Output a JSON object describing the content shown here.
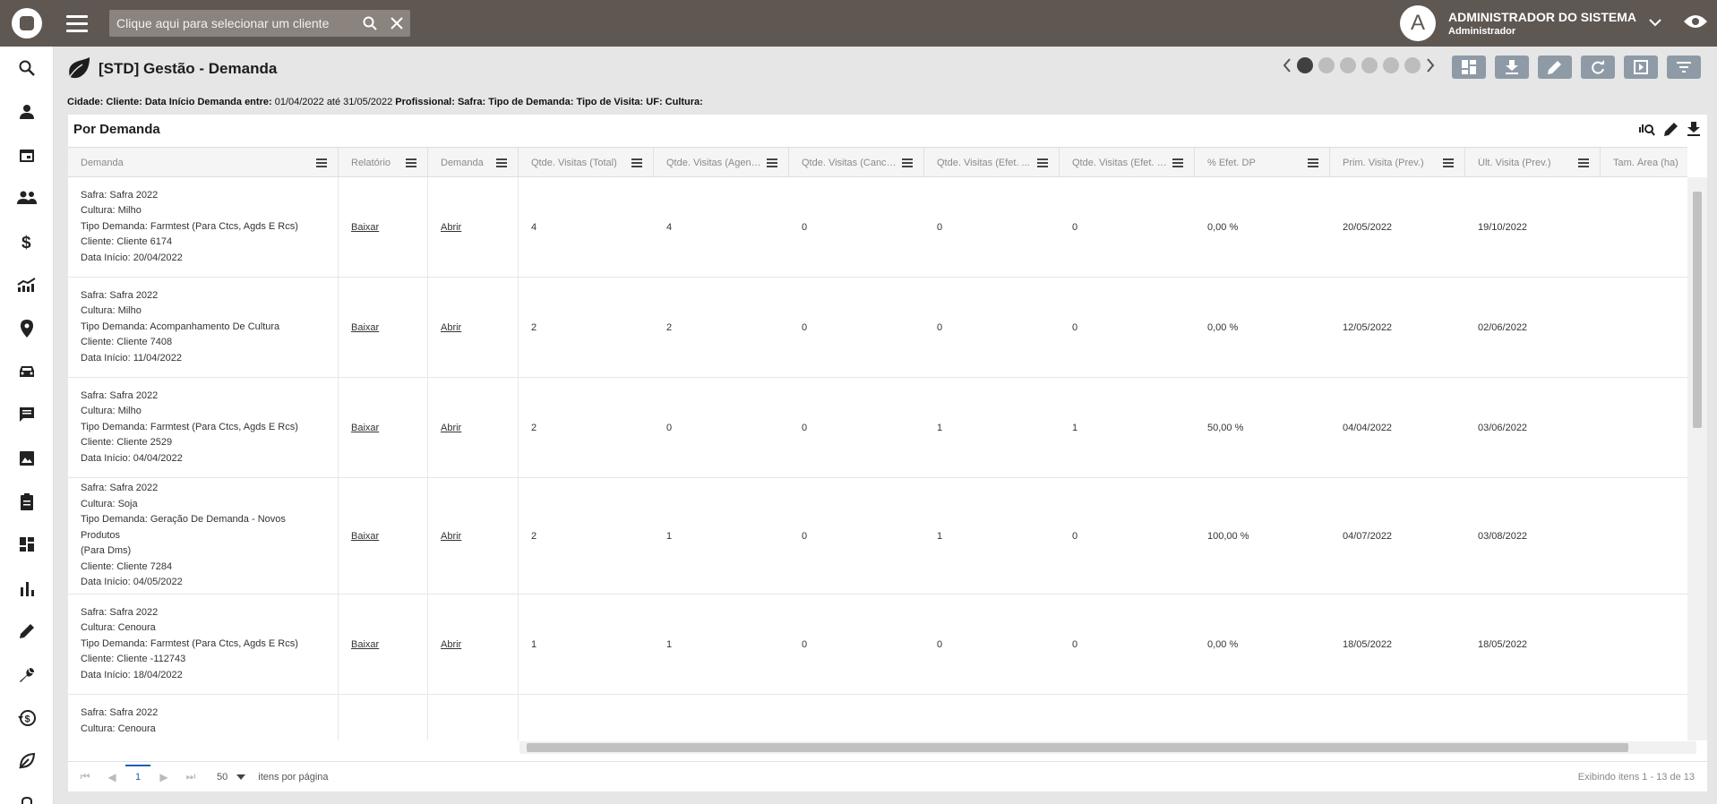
{
  "search": {
    "placeholder": "Clique aqui para selecionar um cliente"
  },
  "user": {
    "initial": "A",
    "name": "ADMINISTRADOR DO SISTEMA",
    "role": "Administrador"
  },
  "page": {
    "title": "[STD] Gestão - Demanda"
  },
  "filters": {
    "cidade": "Cidade:",
    "cliente": "Cliente:",
    "data_label": "Data Início Demanda entre:",
    "data_value": "01/04/2022 até 31/05/2022",
    "profissional": "Profissional:",
    "safra": "Safra:",
    "tipo_demanda": "Tipo de Demanda:",
    "tipo_visita": "Tipo de Visita:",
    "uf": "UF:",
    "cultura": "Cultura:"
  },
  "panel": {
    "title": "Por Demanda"
  },
  "columns": [
    "Demanda",
    "Relatório",
    "Demanda",
    "Qtde. Visitas (Total)",
    "Qtde. Visitas (Agend...",
    "Qtde. Visitas (Cancel...",
    "Qtde. Visitas (Efet. ...",
    "Qtde. Visitas (Efet. F...",
    "% Efet. DP",
    "Prim. Visita (Prev.)",
    "Últ. Visita (Prev.)",
    "Tam. Área (ha)"
  ],
  "rows": [
    {
      "lines": [
        "Safra: Safra 2022",
        "Cultura: Milho",
        "Tipo Demanda: Farmtest (Para Ctcs, Agds E Rcs)",
        "Cliente: Cliente 6174",
        "Data Início: 20/04/2022"
      ],
      "relatorio": "Baixar",
      "demanda": "Abrir",
      "total": "4",
      "agend": "4",
      "cancel": "0",
      "efet": "0",
      "efetf": "0",
      "pct": "0,00 %",
      "prim": "20/05/2022",
      "ult": "19/10/2022",
      "area": ""
    },
    {
      "lines": [
        "Safra: Safra 2022",
        "Cultura: Milho",
        "Tipo Demanda: Acompanhamento De Cultura",
        "Cliente: Cliente 7408",
        "Data Início: 11/04/2022"
      ],
      "relatorio": "Baixar",
      "demanda": "Abrir",
      "total": "2",
      "agend": "2",
      "cancel": "0",
      "efet": "0",
      "efetf": "0",
      "pct": "0,00 %",
      "prim": "12/05/2022",
      "ult": "02/06/2022",
      "area": ""
    },
    {
      "lines": [
        "Safra: Safra 2022",
        "Cultura: Milho",
        "Tipo Demanda: Farmtest (Para Ctcs, Agds E Rcs)",
        "Cliente: Cliente 2529",
        "Data Início: 04/04/2022"
      ],
      "relatorio": "Baixar",
      "demanda": "Abrir",
      "total": "2",
      "agend": "0",
      "cancel": "0",
      "efet": "1",
      "efetf": "1",
      "pct": "50,00 %",
      "prim": "04/04/2022",
      "ult": "03/06/2022",
      "area": ""
    },
    {
      "lines": [
        "Safra: Safra 2022",
        "Cultura: Soja",
        "Tipo Demanda: Geração De Demanda - Novos Produtos",
        "(Para Dms)",
        "Cliente: Cliente 7284",
        "Data Início: 04/05/2022"
      ],
      "relatorio": "Baixar",
      "demanda": "Abrir",
      "total": "2",
      "agend": "1",
      "cancel": "0",
      "efet": "1",
      "efetf": "0",
      "pct": "100,00 %",
      "prim": "04/07/2022",
      "ult": "03/08/2022",
      "area": ""
    },
    {
      "lines": [
        "Safra: Safra 2022",
        "Cultura: Cenoura",
        "Tipo Demanda: Farmtest (Para Ctcs, Agds E Rcs)",
        "Cliente: Cliente -112743",
        "Data Início: 18/04/2022"
      ],
      "relatorio": "Baixar",
      "demanda": "Abrir",
      "total": "1",
      "agend": "1",
      "cancel": "0",
      "efet": "0",
      "efetf": "0",
      "pct": "0,00 %",
      "prim": "18/05/2022",
      "ult": "18/05/2022",
      "area": ""
    },
    {
      "lines": [
        "Safra: Safra 2022",
        "Cultura: Cenoura"
      ],
      "relatorio": "",
      "demanda": "",
      "total": "",
      "agend": "",
      "cancel": "",
      "efet": "",
      "efetf": "",
      "pct": "",
      "prim": "",
      "ult": "",
      "area": ""
    }
  ],
  "pager": {
    "current": "1",
    "size": "50",
    "size_label": "itens por página",
    "info": "Exibindo itens 1 - 13 de 13"
  },
  "colors": {
    "topbar": "#5f5752",
    "toolbtn": "#8e9ba6",
    "dot_active": "#404040"
  }
}
